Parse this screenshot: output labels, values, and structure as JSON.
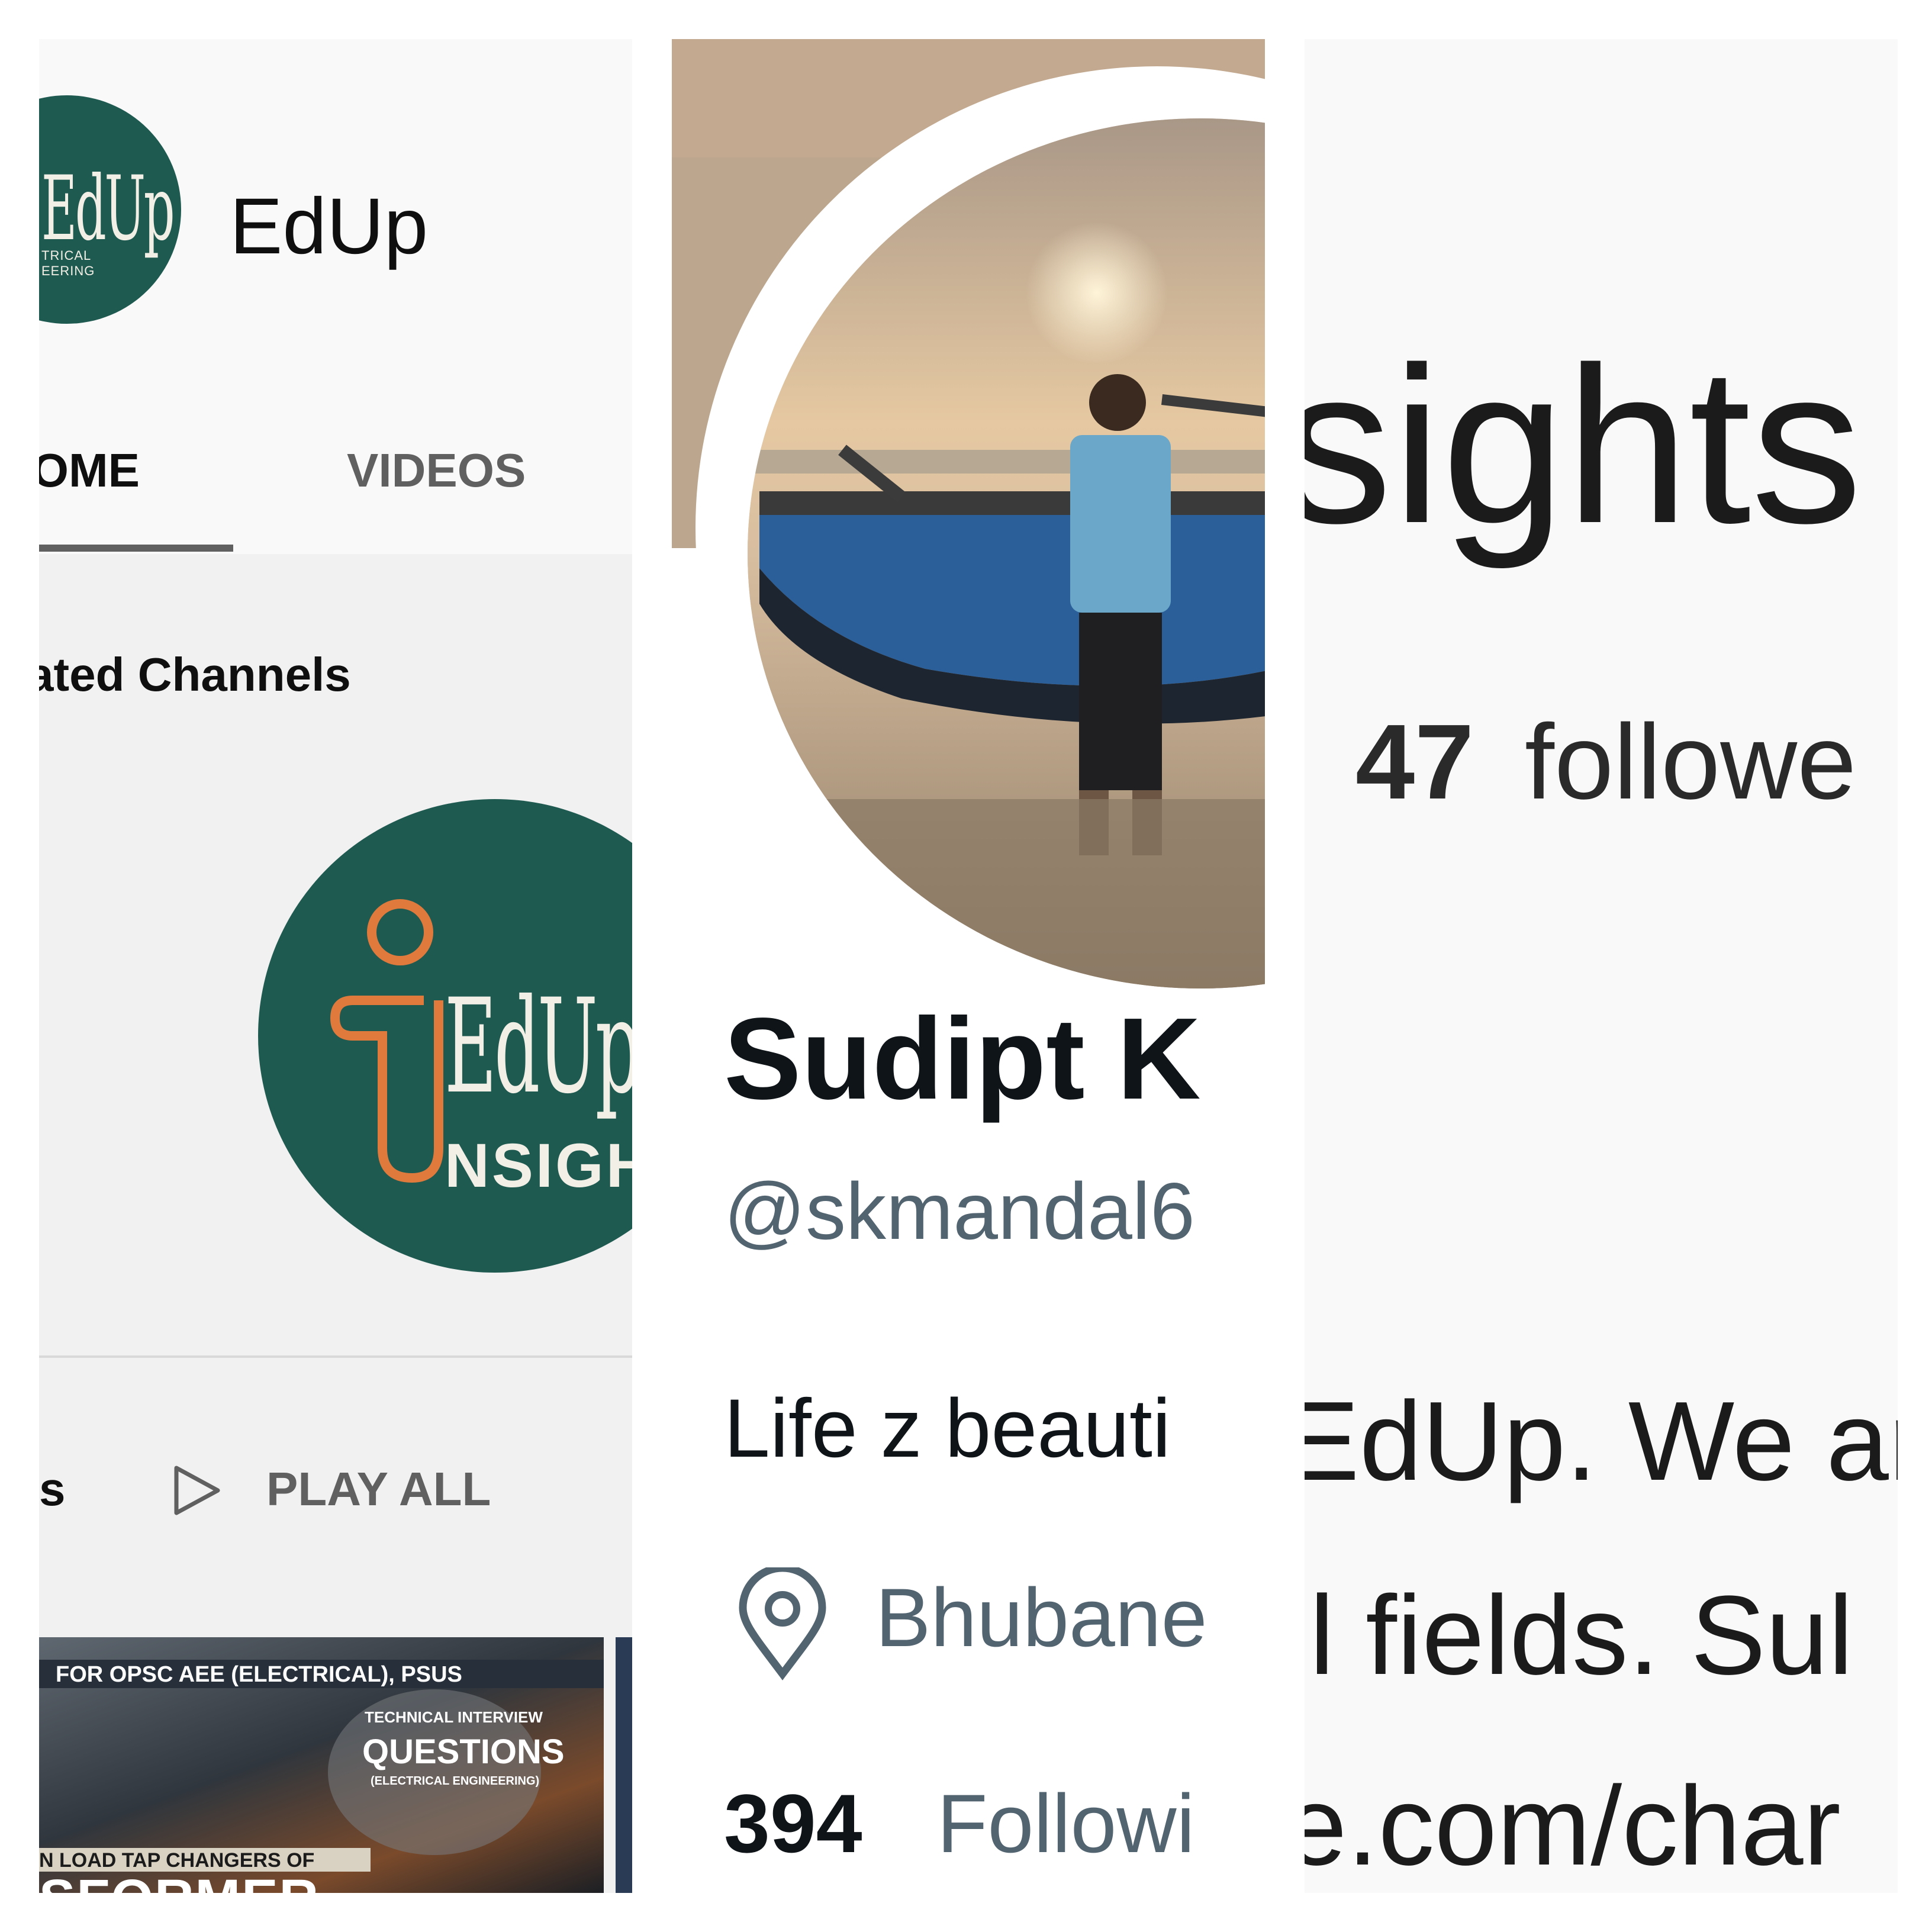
{
  "youtube": {
    "channel_name": "EdUp",
    "avatar_logo": "EdUp",
    "avatar_sub1": "TRICAL",
    "avatar_sub2": "EERING",
    "tabs": [
      "HOME",
      "VIDEOS"
    ],
    "visible_tab_fragment": "ME",
    "featured_section_title": "ated Channels",
    "featured_channel_logo": "EdUp",
    "featured_channel_sub": "NSIGHT",
    "playlist_fragment": "s",
    "play_all_label": "PLAY ALL",
    "video_thumbnail": {
      "banner": "FOR OPSC AEE (ELECTRICAL), PSUS",
      "tagline": "TECHNICAL INTERVIEW",
      "headline": "QUESTIONS",
      "subline": "(ELECTRICAL ENGINEERING)",
      "topic": "N LOAD TAP CHANGERS OF",
      "title": "SFORMER"
    },
    "colors": {
      "brand_green": "#1f5a51",
      "brand_orange": "#e07a3c"
    }
  },
  "twitter": {
    "display_name": "Sudipt K",
    "handle": "@skmandal6",
    "bio": "Life z beauti",
    "location": "Bhubane",
    "following_count": "394",
    "following_label": "Followi",
    "location_icon": "location-pin-icon"
  },
  "panel3": {
    "title": "sights",
    "followers_count": "47",
    "followers_label": "followe",
    "about_line1": "EdUp. We ar",
    "about_line2": "ll fields. Sul",
    "about_line3": "e.com/char"
  }
}
